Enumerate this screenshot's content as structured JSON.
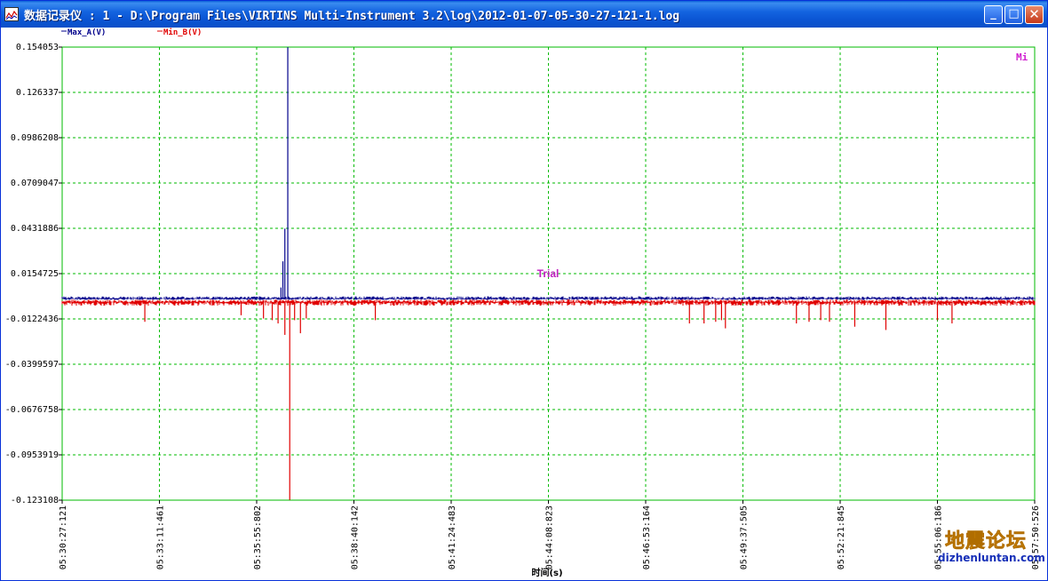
{
  "window": {
    "title": "数据记录仪 : 1 - D:\\Program Files\\VIRTINS Multi-Instrument 3.2\\log\\2012-01-07-05-30-27-121-1.log",
    "buttons": {
      "minimize": "_",
      "maximize": "□",
      "close": "✕"
    }
  },
  "legend": {
    "series_a": "Max_A(V)",
    "series_b": "Min_B(V)"
  },
  "mi_label": "Mi",
  "trial_label": "Trial",
  "watermark": {
    "cn": "地震论坛",
    "url": "dizhenluntan.com"
  },
  "colors": {
    "series_a": "#00008b",
    "series_b": "#e00000",
    "grid": "#00bb00",
    "trial": "#c020c0"
  },
  "chart_data": {
    "type": "line",
    "xlabel": "时间(s)",
    "ylabel": "",
    "x_ticks": [
      "05:30:27:121",
      "05:33:11:461",
      "05:35:55:802",
      "05:38:40:142",
      "05:41:24:483",
      "05:44:08:823",
      "05:46:53:164",
      "05:49:37:505",
      "05:52:21:845",
      "05:55:06:186",
      "05:57:50:526"
    ],
    "y_ticks": [
      "0.154053",
      "0.126337",
      "0.0986208",
      "0.0709047",
      "0.0431886",
      "0.0154725",
      "-0.0122436",
      "-0.0399597",
      "-0.0676758",
      "-0.0953919",
      "-0.123108"
    ],
    "ylim": [
      -0.123108,
      0.154053
    ],
    "grid": true,
    "series": [
      {
        "name": "Max_A(V)",
        "baseline": 0.0002,
        "spikes": [
          [
            2.25,
            0.007
          ],
          [
            2.27,
            0.023
          ],
          [
            2.29,
            0.043
          ],
          [
            2.32,
            0.154
          ]
        ]
      },
      {
        "name": "Min_B(V)",
        "baseline": -0.002,
        "spikes": [
          [
            0.85,
            -0.014
          ],
          [
            1.84,
            -0.01
          ],
          [
            2.07,
            -0.012
          ],
          [
            2.16,
            -0.013
          ],
          [
            2.22,
            -0.015
          ],
          [
            2.29,
            -0.022
          ],
          [
            2.34,
            -0.123
          ],
          [
            2.39,
            -0.013
          ],
          [
            2.45,
            -0.021
          ],
          [
            2.51,
            -0.012
          ],
          [
            3.22,
            -0.013
          ],
          [
            6.45,
            -0.015
          ],
          [
            6.6,
            -0.015
          ],
          [
            6.72,
            -0.014
          ],
          [
            6.78,
            -0.013
          ],
          [
            6.82,
            -0.018
          ],
          [
            7.55,
            -0.015
          ],
          [
            7.68,
            -0.014
          ],
          [
            7.8,
            -0.013
          ],
          [
            7.89,
            -0.014
          ],
          [
            8.15,
            -0.017
          ],
          [
            8.47,
            -0.019
          ],
          [
            9.0,
            -0.013
          ],
          [
            9.15,
            -0.015
          ]
        ]
      }
    ]
  }
}
